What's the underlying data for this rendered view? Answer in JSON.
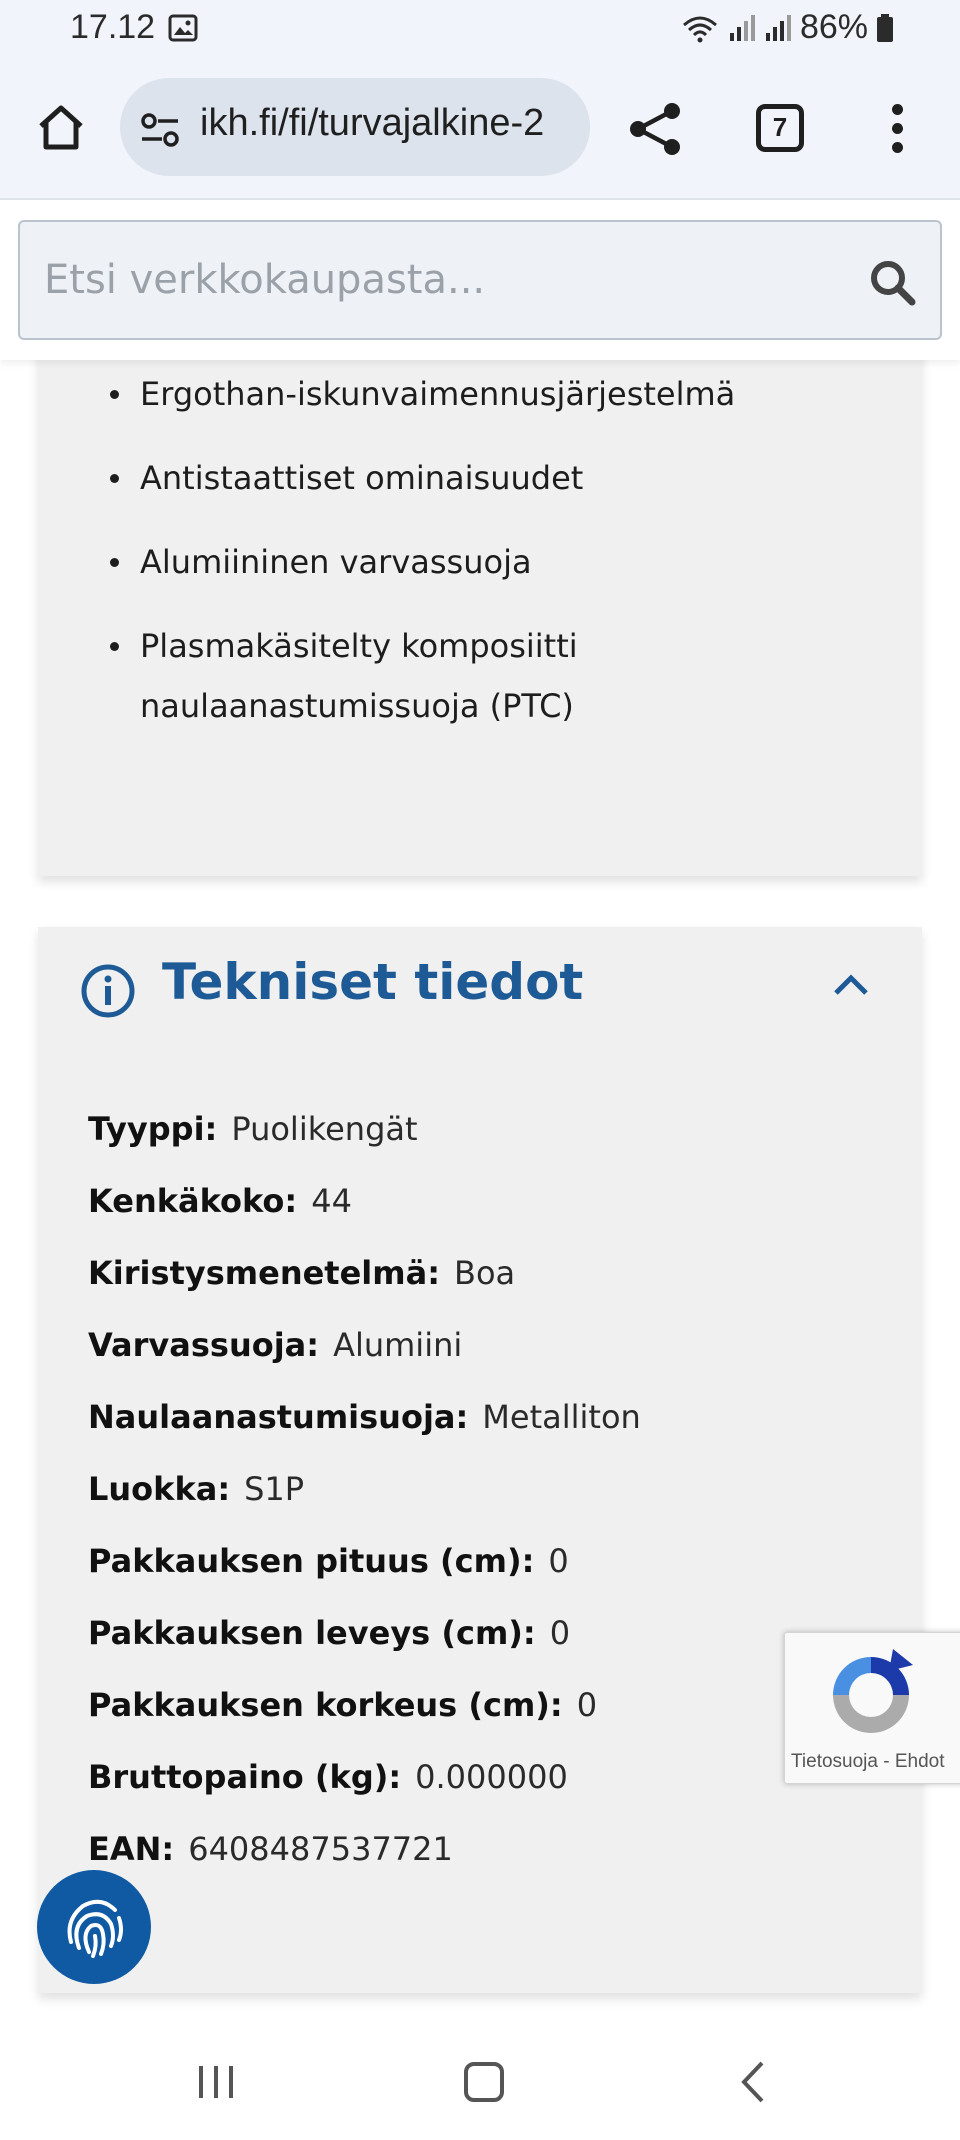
{
  "status_bar": {
    "time": "17.12",
    "battery": "86%",
    "icons": [
      "gallery-icon",
      "wifi-icon",
      "signal-icon",
      "signal-icon",
      "battery-icon"
    ]
  },
  "browser": {
    "url": "ikh.fi/fi/turvajalkine-2",
    "tab_count": "7",
    "icons": [
      "home-icon",
      "site-settings-icon",
      "share-icon",
      "tabs-icon",
      "more-menu-icon"
    ]
  },
  "search": {
    "placeholder": "Etsi verkkokaupasta..."
  },
  "features": {
    "items": [
      "Ergothan-iskunvaimennusjärjestelmä",
      "Antistaattiset ominaisuudet",
      "Alumiininen varvassuoja",
      "Plasmakäsitelty komposiitti naulaanastumissuoja (PTC)"
    ]
  },
  "tech": {
    "title": "Tekniset tiedot",
    "expanded": true,
    "rows": [
      {
        "label": "Tyyppi:",
        "value": "Puolikengät"
      },
      {
        "label": "Kenkäkoko:",
        "value": "44"
      },
      {
        "label": "Kiristysmenetelmä:",
        "value": "Boa"
      },
      {
        "label": "Varvassuoja:",
        "value": "Alumiini"
      },
      {
        "label": "Naulaanastumisuoja:",
        "value": "Metalliton"
      },
      {
        "label": "Luokka:",
        "value": "S1P"
      },
      {
        "label": "Pakkauksen pituus (cm):",
        "value": "0"
      },
      {
        "label": "Pakkauksen leveys (cm):",
        "value": "0"
      },
      {
        "label": "Pakkauksen korkeus (cm):",
        "value": "0"
      },
      {
        "label": "Bruttopaino (kg):",
        "value": "0.000000"
      },
      {
        "label": "EAN:",
        "value": "6408487537721"
      }
    ]
  },
  "recaptcha": {
    "links": "Tietosuoja - Ehdot"
  },
  "colors": {
    "accent": "#1e5b96",
    "fingerprint_button": "#0f5aa3",
    "card_background": "#f0f0f0"
  }
}
